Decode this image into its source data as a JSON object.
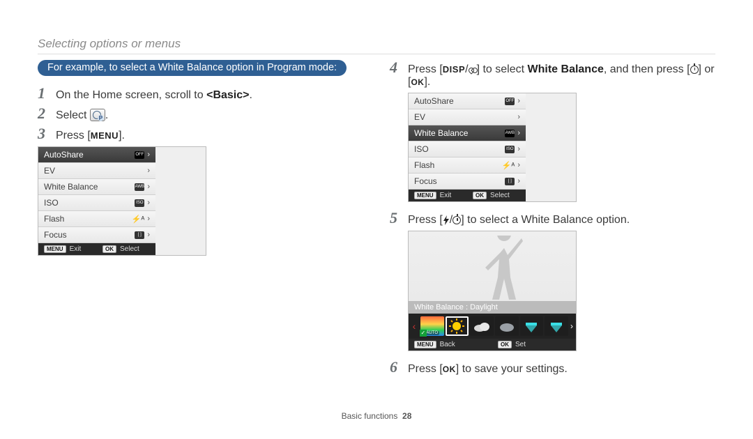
{
  "header": {
    "title": "Selecting options or menus"
  },
  "blue_bar": "For example, to select a White Balance option in Program mode:",
  "steps": {
    "s1_pre": "On the Home screen, scroll to ",
    "s1_basic": "<Basic>",
    "s1_post": ".",
    "s2_pre": "Select ",
    "s2_post": ".",
    "s3_pre": "Press [",
    "s3_menu": "MENU",
    "s3_post": "].",
    "s4_pre": "Press [",
    "s4_disp": "DISP",
    "s4_mid": "] to select ",
    "s4_wb": "White Balance",
    "s4_then": ", and then press [",
    "s4_or": "] or [",
    "s4_ok": "OK",
    "s4_end": "].",
    "s5_pre": "Press [",
    "s5_mid": "] to select a White Balance option.",
    "s6_pre": "Press [",
    "s6_ok": "OK",
    "s6_post": "] to save your settings."
  },
  "menu": {
    "items": [
      {
        "label": "AutoShare",
        "icon": "share-off"
      },
      {
        "label": "EV"
      },
      {
        "label": "White Balance",
        "icon": "awb"
      },
      {
        "label": "ISO",
        "icon": "iso-auto"
      },
      {
        "label": "Flash",
        "icon": "flash-auto"
      },
      {
        "label": "Focus",
        "icon": "focus"
      }
    ],
    "footer_exit": "Exit",
    "footer_select": "Select",
    "footer_menu": "MENU",
    "footer_ok": "OK"
  },
  "wb_screen": {
    "label": "White Balance : Daylight",
    "auto_text": "AUTO",
    "footer_back": "Back",
    "footer_set": "Set",
    "footer_menu": "MENU",
    "footer_ok": "OK"
  },
  "footer": {
    "section": "Basic functions",
    "page": "28"
  }
}
